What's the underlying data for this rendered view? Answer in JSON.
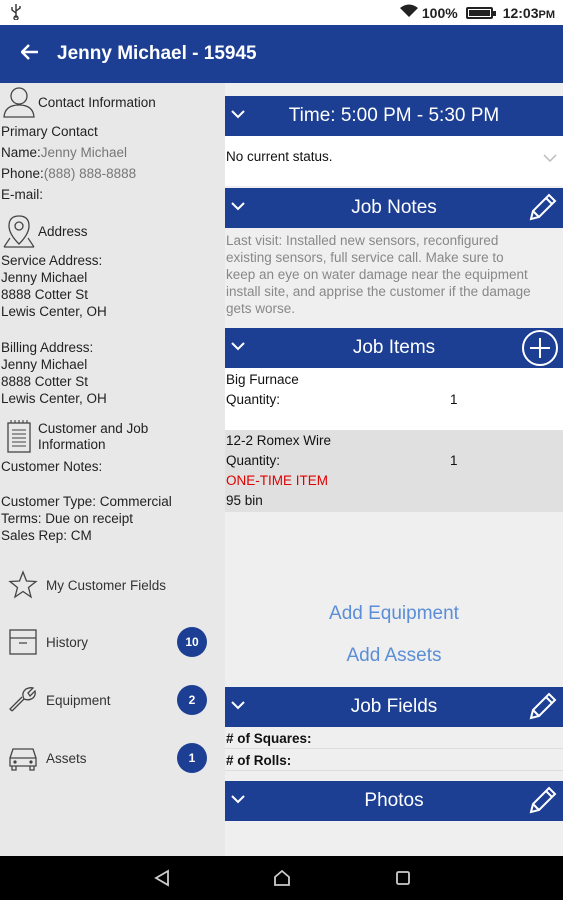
{
  "status_bar": {
    "battery": "100%",
    "time": "12:03",
    "ampm": "PM"
  },
  "app_bar": {
    "title": "Jenny Michael - 15945"
  },
  "contact": {
    "heading": "Contact Information",
    "primary_label": "Primary Contact",
    "name_label": "Name:",
    "name_value": "Jenny Michael",
    "phone_label": "Phone:",
    "phone_value": "(888) 888-8888",
    "email_label": "E-mail:"
  },
  "address": {
    "heading": "Address",
    "service_label": "Service Address:",
    "service_lines": [
      "Jenny Michael",
      "8888 Cotter St",
      "Lewis Center, OH"
    ],
    "billing_label": "Billing Address:",
    "billing_lines": [
      "Jenny Michael",
      "8888 Cotter St",
      "Lewis Center, OH"
    ]
  },
  "customer_info": {
    "heading_line1": "Customer and Job",
    "heading_line2": "Information",
    "notes_label": "Customer Notes:",
    "type": "Customer Type: Commercial",
    "terms": "Terms: Due on receipt",
    "sales_rep": "Sales Rep: CM"
  },
  "nav": {
    "custom_fields": "My Customer Fields",
    "history": "History",
    "history_count": "10",
    "equipment": "Equipment",
    "equipment_count": "2",
    "assets": "Assets",
    "assets_count": "1"
  },
  "time_section": {
    "label": "Time: 5:00 PM - 5:30 PM",
    "status": "No current status."
  },
  "job_notes": {
    "label": "Job Notes",
    "lines": [
      "Last visit: Installed new sensors, reconfigured",
      "existing sensors, full service call. Make sure to",
      "keep an eye on water damage near the equipment",
      "install site, and apprise the customer if the damage",
      "gets worse."
    ]
  },
  "job_items": {
    "label": "Job Items",
    "items": [
      {
        "name": "Big Furnace",
        "qty_label": "Quantity:",
        "qty": "1"
      },
      {
        "name": "12-2 Romex Wire",
        "qty_label": "Quantity:",
        "qty": "1",
        "tag": "ONE-TIME ITEM",
        "location": "95 bin"
      }
    ]
  },
  "links": {
    "add_equipment": "Add Equipment",
    "add_assets": "Add Assets"
  },
  "job_fields": {
    "label": "Job Fields",
    "rows": [
      "# of Squares:",
      "# of Rolls:"
    ]
  },
  "photos": {
    "label": "Photos"
  },
  "colors": {
    "primary": "#1c3f94",
    "link": "#5b8ed6",
    "alert": "#e00000"
  }
}
